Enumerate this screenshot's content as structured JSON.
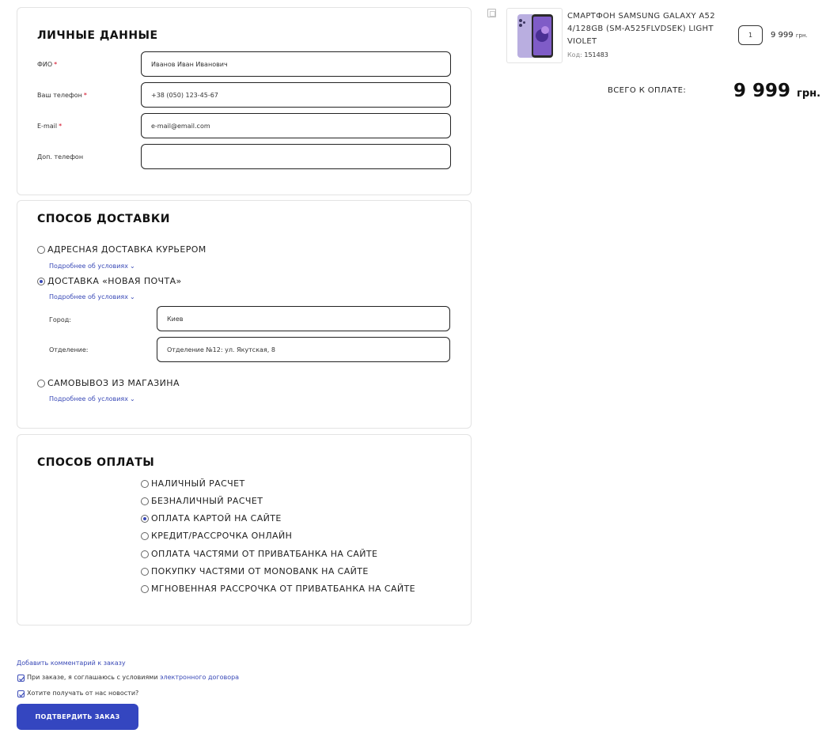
{
  "personal": {
    "title": "ЛИЧНЫЕ ДАННЫЕ",
    "fio_label": "ФИО",
    "fio_value": "Иванов Иван Иванович",
    "phone_label": "Ваш телефон",
    "phone_value": "+38 (050) 123-45-67",
    "email_label": "E-mail",
    "email_value": "e-mail@email.com",
    "extra_phone_label": "Доп. телефон",
    "extra_phone_value": "",
    "required_mark": "*"
  },
  "delivery": {
    "title": "СПОСОБ ДОСТАВКИ",
    "options": [
      {
        "label": "АДРЕСНАЯ ДОСТАВКА КУРЬЕРОМ",
        "selected": false
      },
      {
        "label": "ДОСТАВКА «НОВАЯ ПОЧТА»",
        "selected": true
      },
      {
        "label": "САМОВЫВОЗ ИЗ МАГАЗИНА",
        "selected": false
      }
    ],
    "more_link": "Подробнее об условиях",
    "city_label": "Город:",
    "city_value": "Киев",
    "branch_label": "Отделение:",
    "branch_value": "Отделение №12: ул. Якутская, 8"
  },
  "payment": {
    "title": "СПОСОБ ОПЛАТЫ",
    "options": [
      {
        "label": "НАЛИЧНЫЙ РАСЧЕТ",
        "selected": false
      },
      {
        "label": "БЕЗНАЛИЧНЫЙ РАСЧЕТ",
        "selected": false
      },
      {
        "label": "ОПЛАТА КАРТОЙ НА САЙТЕ",
        "selected": true
      },
      {
        "label": "КРЕДИТ/РАССРОЧКА ОНЛАЙН",
        "selected": false
      },
      {
        "label": "ОПЛАТА ЧАСТЯМИ ОТ ПРИВАТБАНКА НА САЙТЕ",
        "selected": false
      },
      {
        "label": "ПОКУПКУ ЧАСТЯМИ ОТ MONOBANK НА САЙТЕ",
        "selected": false
      },
      {
        "label": "МГНОВЕННАЯ РАССРОЧКА ОТ ПРИВАТБАНКА НА САЙТЕ",
        "selected": false
      }
    ]
  },
  "footer": {
    "add_comment": "Добавить комментарий к заказу",
    "agree_text": "При заказе, я соглашаюсь с условиями",
    "agree_link": "электронного договора",
    "agree_checked": true,
    "news_text": "Хотите получать от нас новости?",
    "news_checked": true,
    "confirm_label": "ПОДТВЕРДИТЬ ЗАКАЗ"
  },
  "cart": {
    "product_name": "СМАРТФОН SAMSUNG GALAXY A52 4/128GB (SM-A525FLVDSEK) LIGHT VIOLET",
    "code_label": "Код:",
    "code_value": "151483",
    "quantity": "1",
    "price": "9 999",
    "currency": "грн.",
    "total_label": "ВСЕГО К ОПЛАТЕ:",
    "total_value": "9 999",
    "total_currency": "грн."
  },
  "colors": {
    "accent": "#3446c0",
    "link": "#3a4ab7",
    "required": "#d0021b"
  }
}
